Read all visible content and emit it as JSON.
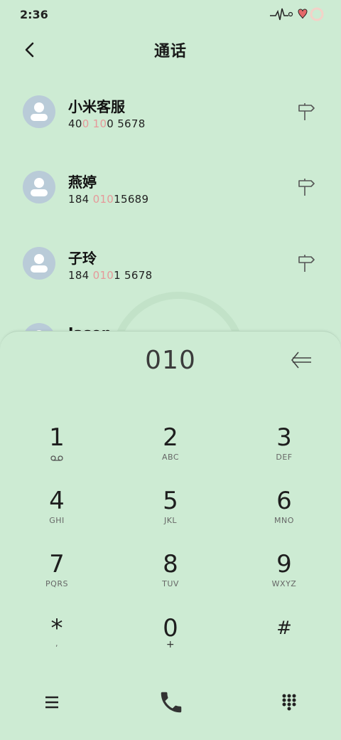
{
  "status": {
    "time": "2:36",
    "icons": [
      "heartbeat-icon",
      "heart-icon",
      "ring-icon"
    ]
  },
  "header": {
    "title": "通话",
    "back_icon": "chevron-left-icon"
  },
  "contacts": [
    {
      "name": "小米客服",
      "number_parts": [
        "40",
        "0 10",
        "0 5678"
      ],
      "highlight_index": 1
    },
    {
      "name": "燕婷",
      "number_parts": [
        "184 ",
        "010",
        "15689"
      ],
      "highlight_index": 1
    },
    {
      "name": "子玲",
      "number_parts": [
        "184 ",
        "010",
        "1 5678"
      ],
      "highlight_index": 1
    },
    {
      "name": "Jason",
      "number_parts": [],
      "highlight_index": -1
    }
  ],
  "dialpad": {
    "input": "010",
    "keys": [
      {
        "digit": "1",
        "letters": "voicemail"
      },
      {
        "digit": "2",
        "letters": "ABC"
      },
      {
        "digit": "3",
        "letters": "DEF"
      },
      {
        "digit": "4",
        "letters": "GHI"
      },
      {
        "digit": "5",
        "letters": "JKL"
      },
      {
        "digit": "6",
        "letters": "MNO"
      },
      {
        "digit": "7",
        "letters": "PQRS"
      },
      {
        "digit": "8",
        "letters": "TUV"
      },
      {
        "digit": "9",
        "letters": "WXYZ"
      },
      {
        "digit": "*",
        "letters": ","
      },
      {
        "digit": "0",
        "letters": "+"
      },
      {
        "digit": "#",
        "letters": ""
      }
    ]
  },
  "bottom_bar": {
    "icons": [
      "menu-icon",
      "phone-icon",
      "keypad-icon"
    ]
  },
  "colors": {
    "background": "#cdebd3",
    "highlight": "#e6999a",
    "avatar": "#b9cbd8"
  }
}
